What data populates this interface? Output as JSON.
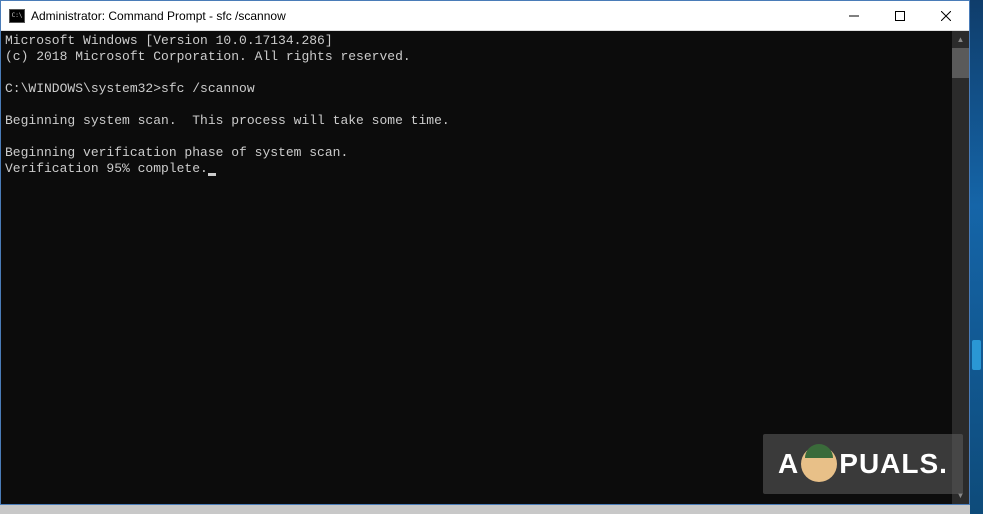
{
  "window": {
    "title": "Administrator: Command Prompt - sfc  /scannow"
  },
  "terminal": {
    "line1": "Microsoft Windows [Version 10.0.17134.286]",
    "line2": "(c) 2018 Microsoft Corporation. All rights reserved.",
    "blank1": "",
    "prompt_line": "C:\\WINDOWS\\system32>sfc /scannow",
    "blank2": "",
    "scan_line": "Beginning system scan.  This process will take some time.",
    "blank3": "",
    "verify_line1": "Beginning verification phase of system scan.",
    "verify_line2": "Verification 95% complete."
  },
  "watermark": {
    "prefix": "A",
    "suffix": "PUALS."
  }
}
